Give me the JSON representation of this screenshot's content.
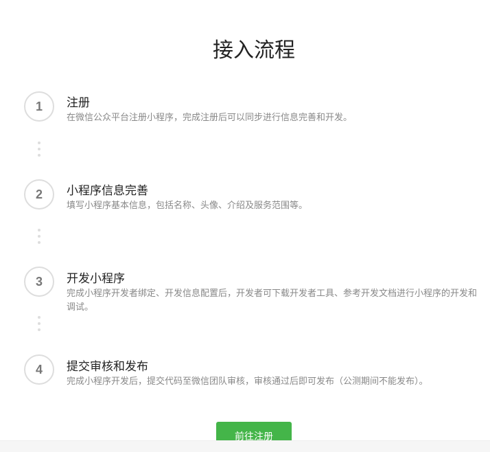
{
  "title": "接入流程",
  "steps": [
    {
      "number": "1",
      "title": "注册",
      "desc": "在微信公众平台注册小程序，完成注册后可以同步进行信息完善和开发。"
    },
    {
      "number": "2",
      "title": "小程序信息完善",
      "desc": "填写小程序基本信息，包括名称、头像、介绍及服务范围等。"
    },
    {
      "number": "3",
      "title": "开发小程序",
      "desc": "完成小程序开发者绑定、开发信息配置后，开发者可下载开发者工具、参考开发文档进行小程序的开发和调试。"
    },
    {
      "number": "4",
      "title": "提交审核和发布",
      "desc": "完成小程序开发后，提交代码至微信团队审核，审核通过后即可发布（公测期间不能发布）。"
    }
  ],
  "button": {
    "label": "前往注册"
  },
  "colors": {
    "accent": "#44b549"
  }
}
